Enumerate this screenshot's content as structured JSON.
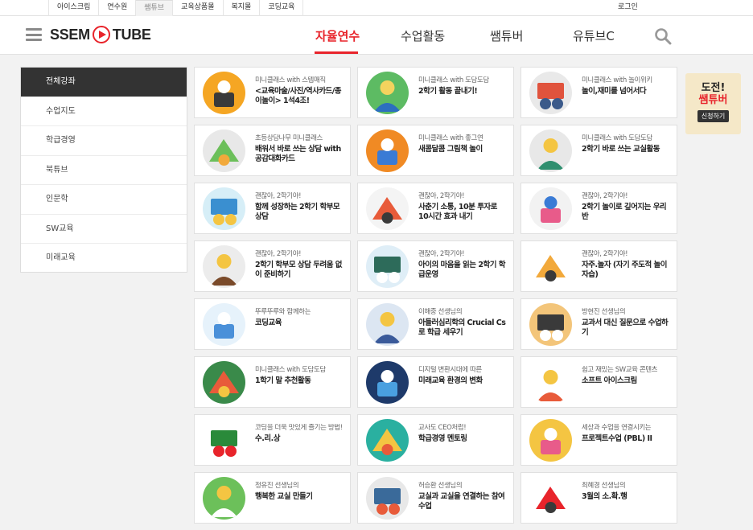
{
  "topbar": {
    "tabs": [
      "아이스크림",
      "연수원",
      "쌤튜브",
      "교육상품몰",
      "복지몰",
      "코딩교육"
    ],
    "login": "로그인"
  },
  "header": {
    "logo_left": "SSEM",
    "logo_right": "TUBE",
    "nav": [
      "자율연수",
      "수업활동",
      "쌤튜버",
      "유튜브C"
    ]
  },
  "sidebar": {
    "items": [
      "전체강좌",
      "수업지도",
      "학급경영",
      "북튜브",
      "인문학",
      "SW교육",
      "미래교육"
    ]
  },
  "cards": [
    {
      "sub": "미니클래스 with 스텝매직",
      "title": "<교육마술/사진/역사카드/종이놀이> 1석4조!",
      "icon": "magic-hat-rabbit-icon"
    },
    {
      "sub": "미니클래스 with 도담도담",
      "title": "2학기 활동 끝내기!",
      "icon": "teacher-with-board-icon"
    },
    {
      "sub": "미니클래스 with 놀이위키",
      "title": "놀이,재미를 넘어서다",
      "icon": "kids-playing-icon"
    },
    {
      "sub": "초등상담나무 미니클래스",
      "title": "배워서 바로 쓰는 상담 with 공감대화카드",
      "icon": "counseling-cards-icon"
    },
    {
      "sub": "미니클래스 with 좋그연",
      "title": "새콤달콤 그림책 놀이",
      "icon": "picture-book-icon"
    },
    {
      "sub": "미니클래스 with 도담도담",
      "title": "2학기 바로 쓰는 교실활동",
      "icon": "classroom-activity-icon"
    },
    {
      "sub": "괜찮아, 2학기야!",
      "title": "함께 성장하는 2학기 학부모 상담",
      "icon": "parent-meeting-icon"
    },
    {
      "sub": "괜찮아, 2학기야!",
      "title": "사춘기 소통, 10분 투자로 10시간 효과 내기",
      "icon": "teens-talking-icon"
    },
    {
      "sub": "괜찮아, 2학기야!",
      "title": "2학기 놀이로 깊어지는 우리 반",
      "icon": "play-together-icon"
    },
    {
      "sub": "괜찮아, 2학기야!",
      "title": "2학기 학부모 상담 두려움 없이 준비하기",
      "icon": "consultation-icon"
    },
    {
      "sub": "괜찮아, 2학기야!",
      "title": "아이의 마음을 읽는 2학기 학급운영",
      "icon": "blackboard-icon"
    },
    {
      "sub": "괜찮아, 2학기야!",
      "title": "자주.놀자 (자기 주도적 놀이 자습)",
      "icon": "student-reading-icon"
    },
    {
      "sub": "뚜루뚜루와 함께하는",
      "title": "코딩교육",
      "icon": "robot-coding-icon"
    },
    {
      "sub": "이해중 선생님의",
      "title": "아들러심리학의 Crucial Cs로 학급 세우기",
      "icon": "school-community-icon"
    },
    {
      "sub": "방현진 선생님의",
      "title": "교과서 대신 질문으로 수업하기",
      "icon": "question-pencil-icon"
    },
    {
      "sub": "미니클래스 with 도담도담",
      "title": "1학기 말 추천활동",
      "icon": "finger-puppets-icon"
    },
    {
      "sub": "디지털 변환시대에 따른",
      "title": "미래교육 환경의 변화",
      "icon": "ai-robot-icon"
    },
    {
      "sub": "쉽고 재밌는 SW교육 콘텐츠",
      "title": "소프트 아이스크림",
      "icon": "soft-icecream-icon"
    },
    {
      "sub": "코딩을 더욱 맛있게 즐기는 방법!",
      "title": "수.리.상",
      "icon": "surisang-logo-icon"
    },
    {
      "sub": "교사도 CEO처럼!",
      "title": "학급경영 멘토링",
      "icon": "mentor-teacher-icon"
    },
    {
      "sub": "세상과 수업을 연결시키는",
      "title": "프로젝트수업 (PBL) II",
      "icon": "project-books-icon"
    },
    {
      "sub": "정유진 선생님의",
      "title": "행복한 교실 만들기",
      "icon": "happy-classroom-icon"
    },
    {
      "sub": "허승환 선생님의",
      "title": "교실과 교실을 연결하는 참여수업",
      "icon": "connected-classroom-icon"
    },
    {
      "sub": "최혜경 선생님의",
      "title": "3월의 소.확.행",
      "icon": "teacher-portrait-icon"
    }
  ],
  "banner": {
    "line1": "도전!",
    "line2": "쌤튜버",
    "button": "신청하기"
  },
  "colors": {
    "accent": "#e8242b",
    "sidebar_active": "#333333",
    "banner_bg": "#f5e8c8"
  }
}
